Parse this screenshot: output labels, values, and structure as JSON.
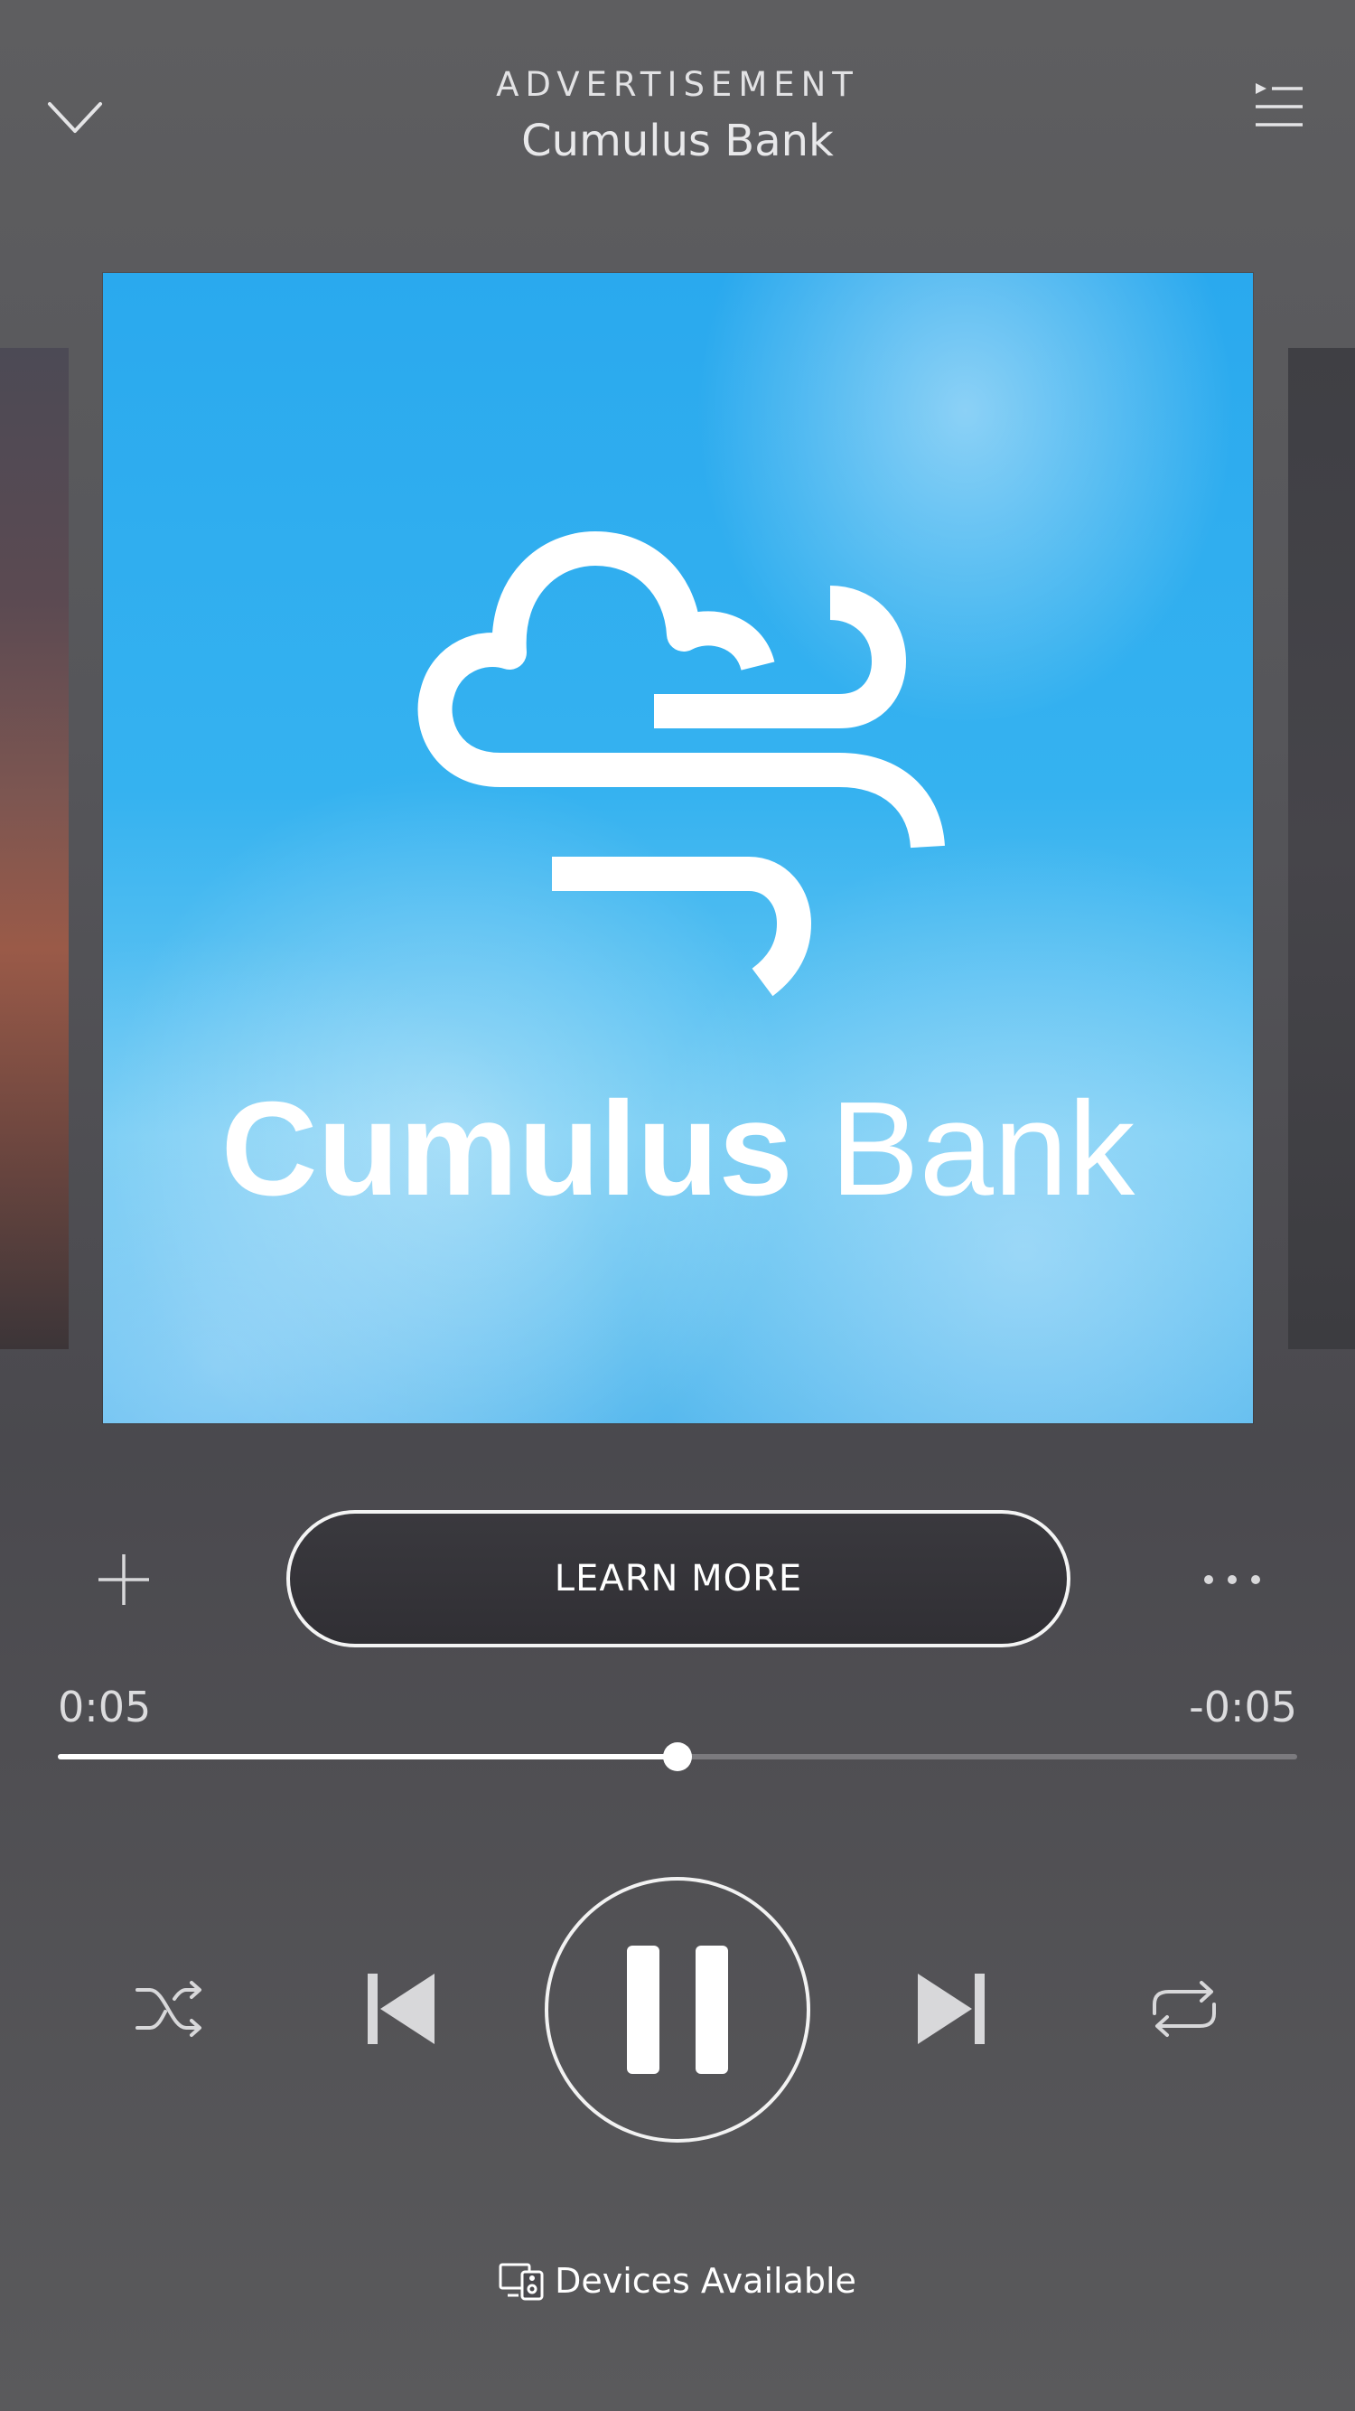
{
  "header": {
    "subtitle": "ADVERTISEMENT",
    "title": "Cumulus Bank"
  },
  "cover": {
    "brand_bold": "Cumulus",
    "brand_light": "Bank",
    "background_color": "#35b2f0"
  },
  "actions": {
    "cta_label": "LEARN MORE"
  },
  "progress": {
    "elapsed": "0:05",
    "remaining": "-0:05",
    "fraction": 0.5
  },
  "controls": {
    "state": "playing",
    "icons": [
      "shuffle-icon",
      "previous-icon",
      "pause-icon",
      "next-icon",
      "repeat-icon"
    ]
  },
  "devices": {
    "label": "Devices Available"
  },
  "colors": {
    "background": "#56565a",
    "accent": "#ffffff"
  }
}
